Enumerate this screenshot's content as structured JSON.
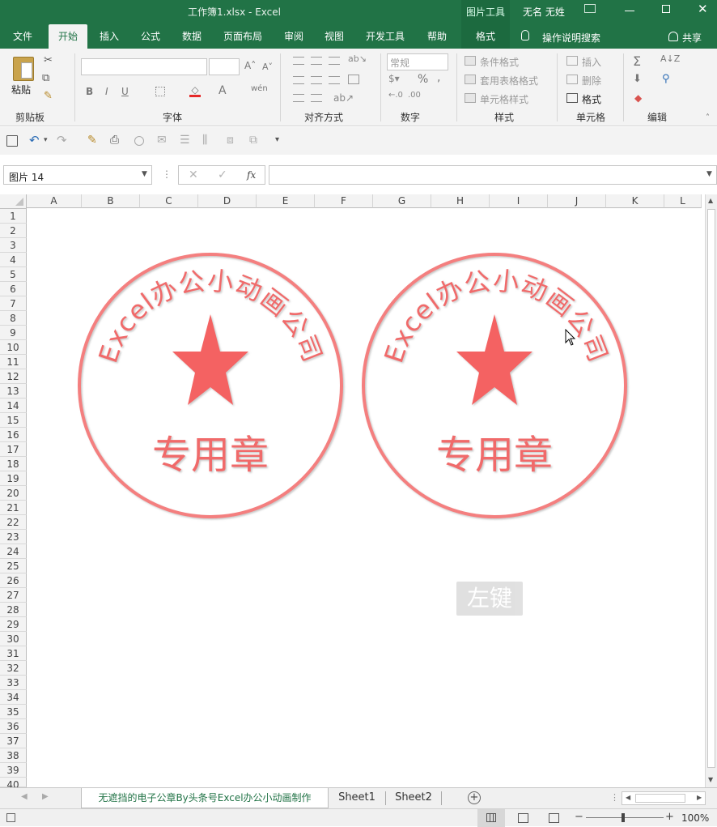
{
  "titlebar": {
    "title": "工作簿1.xlsx  -  Excel",
    "context_tool": "图片工具",
    "user": "无名 无姓"
  },
  "tabs": [
    {
      "label": "文件"
    },
    {
      "label": "开始"
    },
    {
      "label": "插入"
    },
    {
      "label": "公式"
    },
    {
      "label": "数据"
    },
    {
      "label": "页面布局"
    },
    {
      "label": "审阅"
    },
    {
      "label": "视图"
    },
    {
      "label": "开发工具"
    },
    {
      "label": "帮助"
    },
    {
      "label": "格式"
    }
  ],
  "tell_me": "操作说明搜索",
  "share": "共享",
  "ribbon": {
    "clipboard": {
      "paste": "粘贴",
      "label": "剪贴板"
    },
    "font": {
      "label": "字体",
      "phonetic": "wén"
    },
    "alignment": {
      "label": "对齐方式"
    },
    "number": {
      "format": "常规",
      "label": "数字"
    },
    "styles": {
      "conditional": "条件格式",
      "table": "套用表格格式",
      "cell": "单元格样式",
      "label": "样式"
    },
    "cells": {
      "insert": "插入",
      "delete": "删除",
      "format": "格式",
      "label": "单元格"
    },
    "editing": {
      "label": "编辑"
    }
  },
  "namebox": "图片 14",
  "fx": "fx",
  "columns": [
    "A",
    "B",
    "C",
    "D",
    "E",
    "F",
    "G",
    "H",
    "I",
    "J",
    "K",
    "L"
  ],
  "rows": [
    "1",
    "2",
    "3",
    "4",
    "5",
    "6",
    "7",
    "8",
    "9",
    "10",
    "11",
    "12",
    "13",
    "14",
    "15",
    "16",
    "17",
    "18",
    "19",
    "20",
    "21",
    "22",
    "23",
    "24",
    "25",
    "26",
    "27",
    "28",
    "29",
    "30",
    "31",
    "32",
    "33",
    "34",
    "35",
    "36",
    "37",
    "38",
    "39",
    "40"
  ],
  "stamps": [
    {
      "arc_text": "Excel办公小动画公司",
      "center_text": "专用章"
    },
    {
      "arc_text": "Excel办公小动画公司",
      "center_text": "专用章"
    }
  ],
  "overlay_key_label": "左键",
  "sheets": [
    {
      "name": "无遮挡的电子公章By头条号Excel办公小动画制作"
    },
    {
      "name": "Sheet1"
    },
    {
      "name": "Sheet2"
    }
  ],
  "zoom": "100%",
  "colors": {
    "brand": "#217346",
    "stamp": "#f06b6b"
  }
}
